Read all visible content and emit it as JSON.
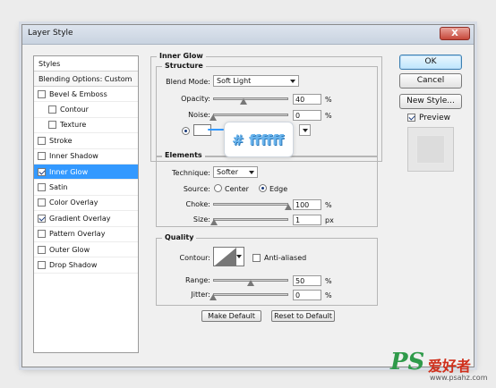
{
  "window": {
    "title": "Layer Style",
    "close_label": "X"
  },
  "styles_panel": {
    "header": "Styles",
    "blending_options": "Blending Options: Custom",
    "items": [
      {
        "label": "Bevel & Emboss",
        "checked": false,
        "sub": false,
        "selected": false
      },
      {
        "label": "Contour",
        "checked": false,
        "sub": true,
        "selected": false
      },
      {
        "label": "Texture",
        "checked": false,
        "sub": true,
        "selected": false
      },
      {
        "label": "Stroke",
        "checked": false,
        "sub": false,
        "selected": false
      },
      {
        "label": "Inner Shadow",
        "checked": false,
        "sub": false,
        "selected": false
      },
      {
        "label": "Inner Glow",
        "checked": true,
        "sub": false,
        "selected": true
      },
      {
        "label": "Satin",
        "checked": false,
        "sub": false,
        "selected": false
      },
      {
        "label": "Color Overlay",
        "checked": false,
        "sub": false,
        "selected": false
      },
      {
        "label": "Gradient Overlay",
        "checked": true,
        "sub": false,
        "selected": false
      },
      {
        "label": "Pattern Overlay",
        "checked": false,
        "sub": false,
        "selected": false
      },
      {
        "label": "Outer Glow",
        "checked": false,
        "sub": false,
        "selected": false
      },
      {
        "label": "Drop Shadow",
        "checked": false,
        "sub": false,
        "selected": false
      }
    ]
  },
  "inner_glow": {
    "title": "Inner Glow",
    "structure": {
      "title": "Structure",
      "blend_mode_label": "Blend Mode:",
      "blend_mode_value": "Soft Light",
      "opacity_label": "Opacity:",
      "opacity_value": "40",
      "opacity_level": 0.4,
      "noise_label": "Noise:",
      "noise_value": "0",
      "noise_level": 0,
      "percent": "%"
    },
    "elements": {
      "title": "Elements",
      "technique_label": "Technique:",
      "technique_value": "Softer",
      "source_label": "Source:",
      "source_center": "Center",
      "source_edge": "Edge",
      "choke_label": "Choke:",
      "choke_value": "100",
      "choke_level": 1.0,
      "size_label": "Size:",
      "size_value": "1",
      "size_unit": "px",
      "size_level": 0.01,
      "percent": "%"
    },
    "quality": {
      "title": "Quality",
      "contour_label": "Contour:",
      "anti_aliased_label": "Anti-aliased",
      "range_label": "Range:",
      "range_value": "50",
      "range_level": 0.5,
      "jitter_label": "Jitter:",
      "jitter_value": "0",
      "jitter_level": 0,
      "percent": "%"
    },
    "make_default_label": "Make Default",
    "reset_default_label": "Reset to Default"
  },
  "color_tooltip": {
    "text": "# ffffff",
    "glow_color": "#ffffff",
    "text_color": "#69b3ec"
  },
  "actions": {
    "ok_label": "OK",
    "cancel_label": "Cancel",
    "new_style_label": "New Style...",
    "preview_label": "Preview"
  },
  "watermark": {
    "brand": "PS",
    "cjk": "爱好者",
    "url": "www.psahz.com"
  }
}
